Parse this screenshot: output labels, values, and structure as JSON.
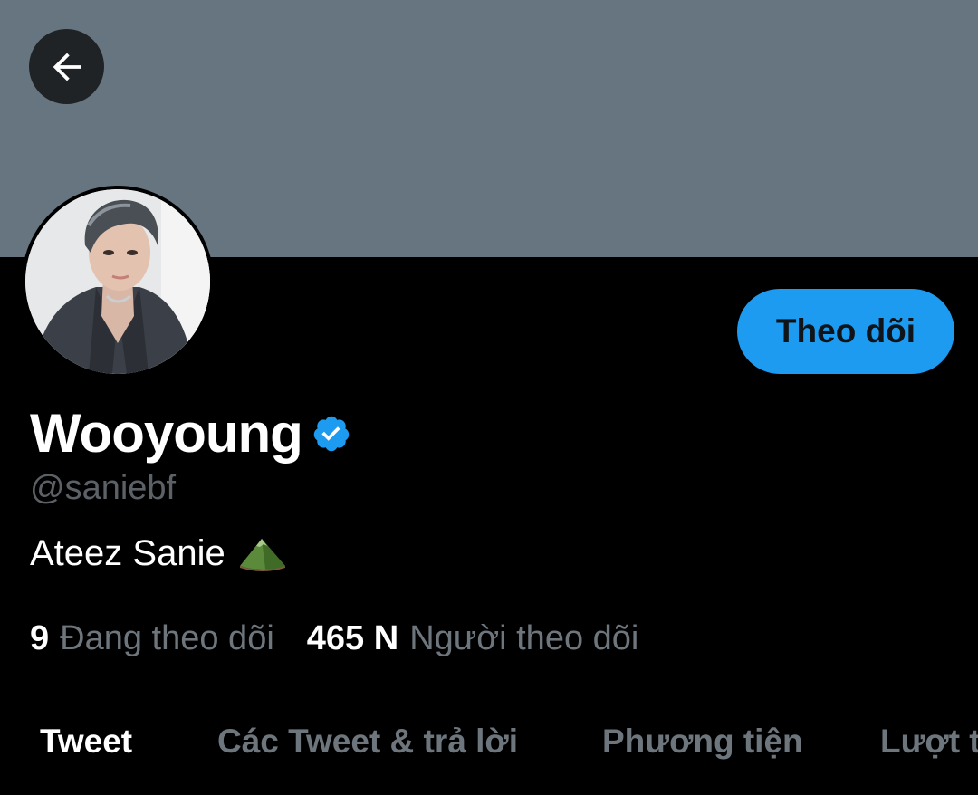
{
  "header": {
    "banner_color": "#66757f",
    "back_icon": "arrow-left-icon"
  },
  "profile": {
    "avatar_icon": "profile-photo",
    "display_name": "Wooyoung",
    "verified_icon": "verified-badge-icon",
    "handle": "@saniebf",
    "bio_text": "Ateez Sanie",
    "bio_emoji_icon": "mountain-emoji-icon",
    "follow_button_label": "Theo dõi",
    "accent_color": "#1d9bf0"
  },
  "stats": {
    "following_count": "9",
    "following_label": "Đang theo dõi",
    "followers_count": "465 N",
    "followers_label": "Người theo dõi"
  },
  "tabs": [
    {
      "label": "Tweet",
      "active": true
    },
    {
      "label": "Các Tweet & trả lời",
      "active": false
    },
    {
      "label": "Phương tiện",
      "active": false
    },
    {
      "label": "Lượt thích",
      "active": false
    }
  ]
}
